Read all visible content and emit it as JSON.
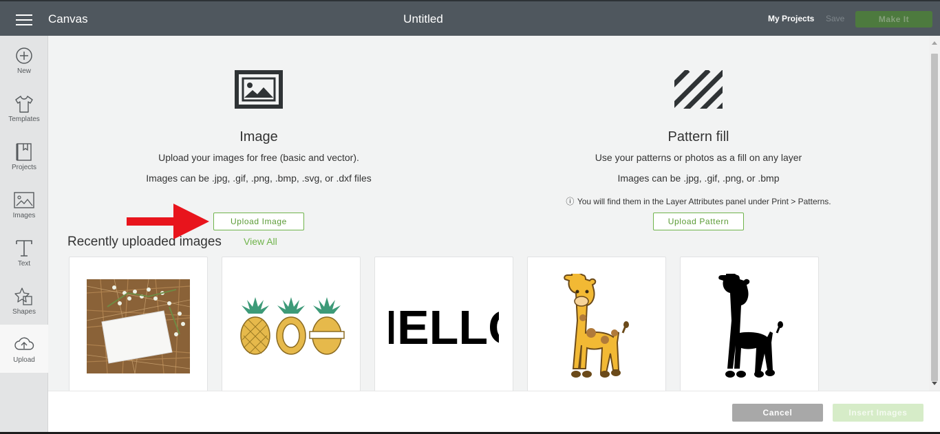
{
  "header": {
    "app_name": "Canvas",
    "document_title": "Untitled",
    "my_projects": "My Projects",
    "save": "Save",
    "make_it": "Make It"
  },
  "sidebar": {
    "items": [
      {
        "label": "New",
        "icon": "plus-circle-icon"
      },
      {
        "label": "Templates",
        "icon": "tshirt-icon"
      },
      {
        "label": "Projects",
        "icon": "bookmark-icon"
      },
      {
        "label": "Images",
        "icon": "image-icon"
      },
      {
        "label": "Text",
        "icon": "text-icon"
      },
      {
        "label": "Shapes",
        "icon": "shapes-icon"
      },
      {
        "label": "Upload",
        "icon": "cloud-upload-icon",
        "active": true
      }
    ]
  },
  "image_section": {
    "icon": "image-icon",
    "title": "Image",
    "line1": "Upload your images for free (basic and vector).",
    "line2": "Images can be .jpg, .gif, .png, .bmp, .svg, or .dxf files",
    "button": "Upload Image"
  },
  "pattern_section": {
    "icon": "stripes-icon",
    "title": "Pattern fill",
    "line1": "Use your patterns or photos as a fill on any layer",
    "line2": "Images can be .jpg, .gif, .png, or .bmp",
    "info_icon": "info-icon",
    "note": "You will find them in the Layer Attributes panel under Print > Patterns.",
    "button": "Upload Pattern"
  },
  "recent": {
    "title": "Recently uploaded images",
    "view_all": "View All",
    "thumbnails": [
      {
        "name": "photo-card-thumbnail"
      },
      {
        "name": "pineapples-thumbnail"
      },
      {
        "name": "hello-thumbnail",
        "text": "HELLO"
      },
      {
        "name": "giraffe-color-thumbnail"
      },
      {
        "name": "giraffe-silhouette-thumbnail"
      }
    ]
  },
  "footer": {
    "cancel": "Cancel",
    "insert": "Insert Images"
  },
  "colors": {
    "header_bg": "#4f575e",
    "accent_green": "#6fb34a",
    "annotation_arrow": "#e8141c"
  }
}
